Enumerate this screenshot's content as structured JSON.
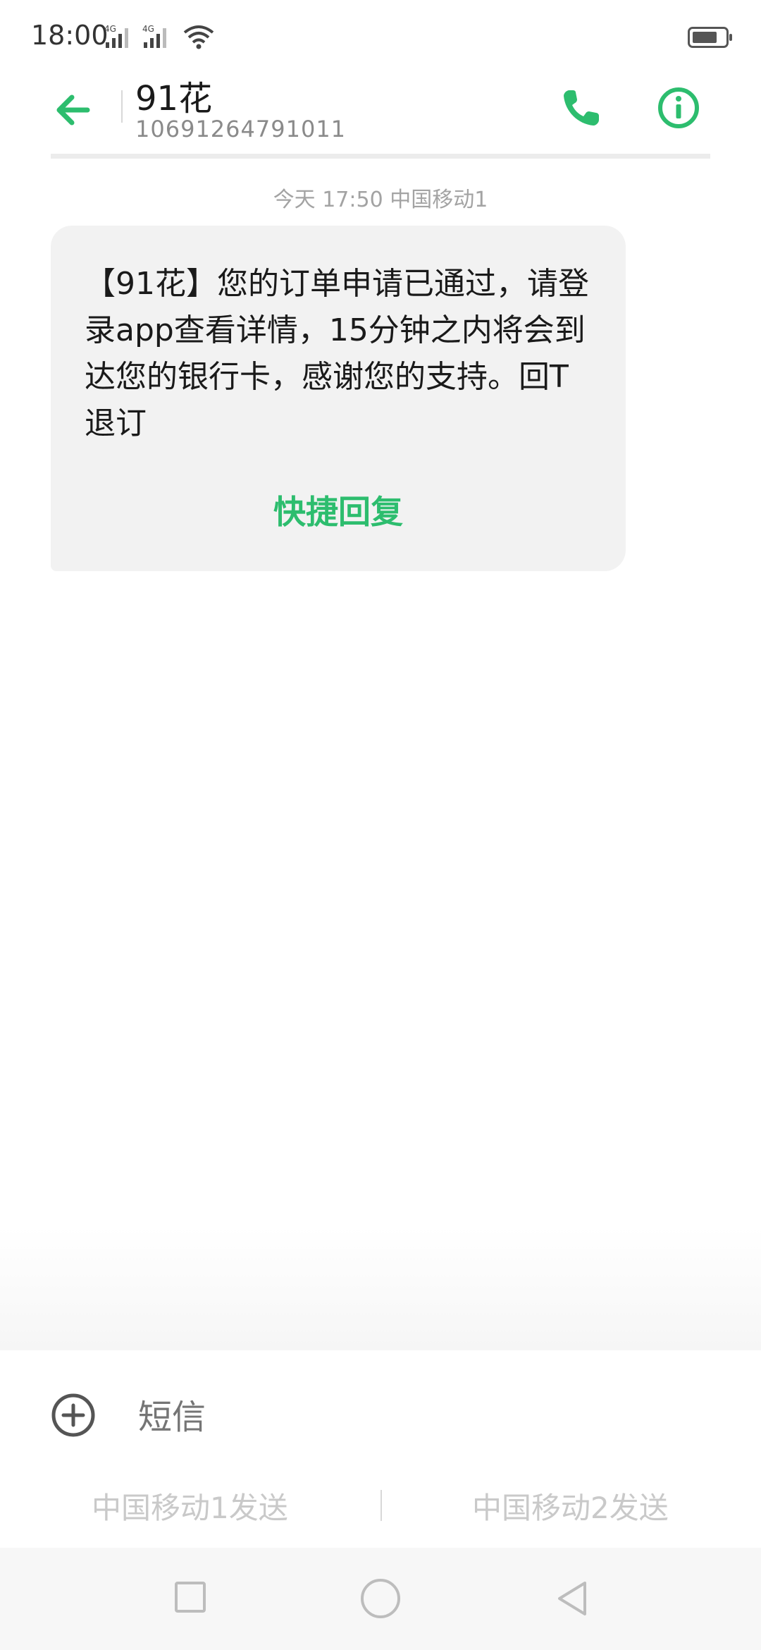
{
  "status_bar": {
    "time": "18:00",
    "signal1_label": "4G",
    "signal2_label": "4G",
    "icons": [
      "signal-4g-icon",
      "signal-4g-icon",
      "wifi-icon",
      "battery-icon"
    ]
  },
  "header": {
    "contact_name": "91花",
    "contact_number": "10691264791011",
    "icons": [
      "back-arrow-icon",
      "phone-icon",
      "info-icon"
    ],
    "accent_color": "#2dbd6e"
  },
  "conversation": {
    "timestamp": "今天 17:50  中国移动1",
    "message_text": "【91花】您的订单申请已通过，请登录app查看详情，15分钟之内将会到达您的银行卡，感谢您的支持。回T退订",
    "quick_reply_label": "快捷回复"
  },
  "compose": {
    "placeholder": "短信",
    "send_sim1_label": "中国移动1发送",
    "send_sim2_label": "中国移动2发送"
  },
  "navbar": {
    "icons": [
      "recent-apps-icon",
      "home-icon",
      "back-icon"
    ]
  }
}
